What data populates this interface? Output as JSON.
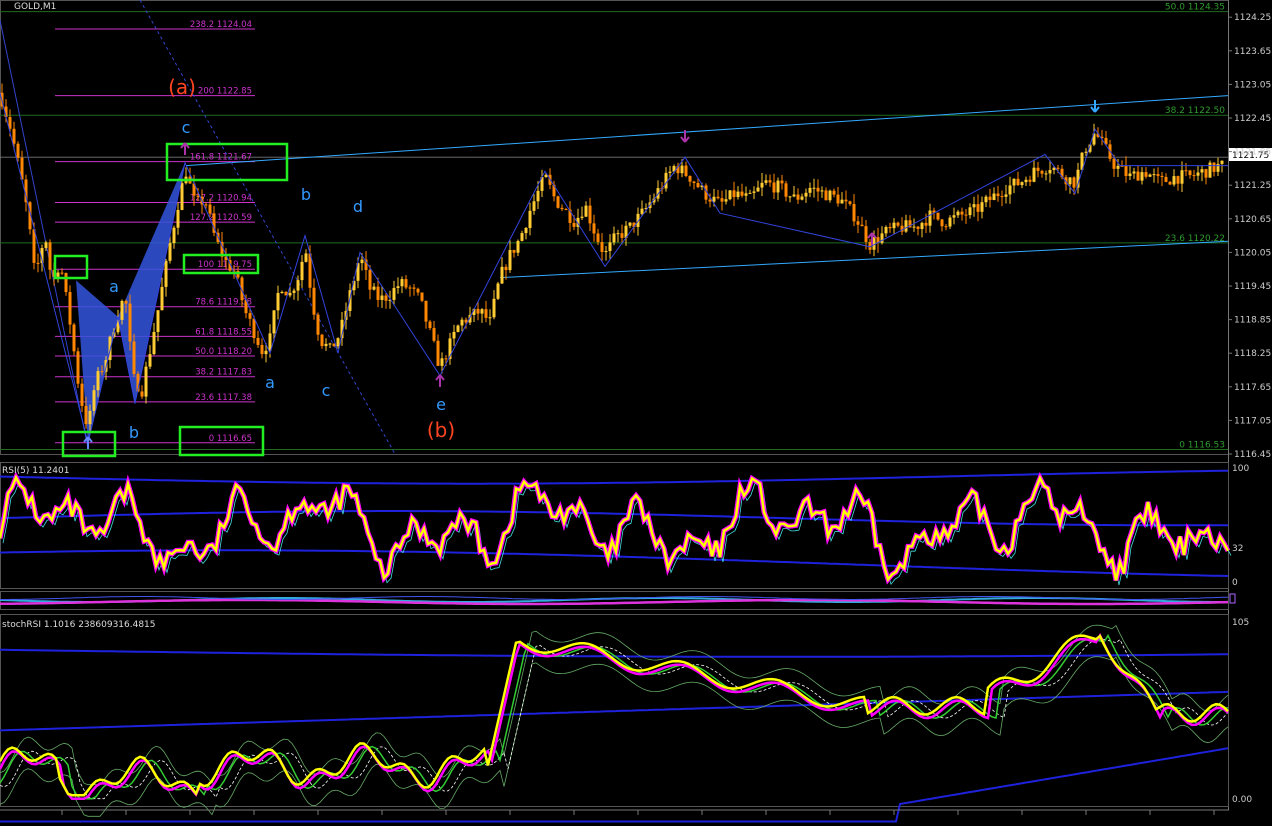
{
  "window": {
    "title": "GOLD,M1"
  },
  "colors": {
    "background": "#000000",
    "bull_candle": "#ffcc33",
    "bear_candle": "#ff8800",
    "grid_green": "#1f6b1f",
    "fib_magenta": "#cc33cc",
    "channel_cyan": "#33aaff",
    "wave_label": "#3399ff",
    "elliott_label": "#ff4422",
    "highlight_box": "#22ee22",
    "harmonic_fill": "#3355dd",
    "rsi_main": "#ffff00",
    "rsi_halo": "#ff00ff",
    "band_blue": "#1e22dd",
    "stoch_green": "#33cc33"
  },
  "price_axis": {
    "ticks": [
      "1124.25",
      "1123.65",
      "1123.05",
      "1122.45",
      "1121.85",
      "1121.25",
      "1120.65",
      "1120.05",
      "1119.45",
      "1118.85",
      "1118.25",
      "1117.65",
      "1117.05",
      "1116.45"
    ],
    "current": "1121.75"
  },
  "fib_levels": [
    {
      "label": "238.2 1124.04"
    },
    {
      "label": "200 1122.85"
    },
    {
      "label": "161.8 1121.67"
    },
    {
      "label": "127.2 1120.94"
    },
    {
      "label": "127.2 1120.59"
    },
    {
      "label": "100 1119.75"
    },
    {
      "label": "78.6 1119.08"
    },
    {
      "label": "61.8 1118.55"
    },
    {
      "label": "50.0 1118.20"
    },
    {
      "label": "38.2 1117.83"
    },
    {
      "label": "23.6 1117.38"
    },
    {
      "label": "0 1116.65"
    }
  ],
  "right_fib": [
    {
      "label": "50.0 1124.35"
    },
    {
      "label": "38.2 1122.50"
    },
    {
      "label": "23.6 1120.22"
    },
    {
      "label": "0 1116.53"
    }
  ],
  "wave_labels": [
    "(a)",
    "c",
    "a",
    "b",
    "b",
    "d",
    "a",
    "c",
    "e",
    "(b)"
  ],
  "rsi_panel": {
    "title": "RSI(5) 11.2401",
    "ticks": [
      "100",
      "32",
      "0"
    ]
  },
  "stoch_panel": {
    "title": "stochRSI 1.1016 238609316.4815",
    "ticks": [
      "105",
      "0.00"
    ]
  },
  "chart_data": {
    "type": "candlestick",
    "title": "GOLD,M1",
    "ylim": [
      1116.45,
      1124.45
    ],
    "price_path": [
      [
        0,
        1122.9
      ],
      [
        10,
        1122.3
      ],
      [
        20,
        1121.5
      ],
      [
        28,
        1120.7
      ],
      [
        35,
        1119.6
      ],
      [
        45,
        1120.4
      ],
      [
        52,
        1119.5
      ],
      [
        60,
        1119.9
      ],
      [
        70,
        1118.8
      ],
      [
        80,
        1117.5
      ],
      [
        88,
        1116.9
      ],
      [
        95,
        1117.7
      ],
      [
        105,
        1118.1
      ],
      [
        115,
        1118.8
      ],
      [
        125,
        1119.3
      ],
      [
        133,
        1117.8
      ],
      [
        142,
        1117.6
      ],
      [
        150,
        1118.3
      ],
      [
        160,
        1119.2
      ],
      [
        170,
        1120.2
      ],
      [
        180,
        1121.1
      ],
      [
        186,
        1121.5
      ],
      [
        195,
        1120.9
      ],
      [
        205,
        1121.0
      ],
      [
        215,
        1120.3
      ],
      [
        225,
        1119.9
      ],
      [
        235,
        1119.7
      ],
      [
        245,
        1119.0
      ],
      [
        255,
        1118.6
      ],
      [
        262,
        1118.3
      ],
      [
        270,
        1118.5
      ],
      [
        280,
        1119.5
      ],
      [
        290,
        1119.3
      ],
      [
        300,
        1119.7
      ],
      [
        305,
        1120.2
      ],
      [
        312,
        1119.2
      ],
      [
        320,
        1118.5
      ],
      [
        330,
        1118.3
      ],
      [
        340,
        1118.6
      ],
      [
        350,
        1119.3
      ],
      [
        360,
        1120.0
      ],
      [
        370,
        1119.4
      ],
      [
        380,
        1119.2
      ],
      [
        390,
        1119.3
      ],
      [
        400,
        1119.5
      ],
      [
        410,
        1119.4
      ],
      [
        420,
        1119.2
      ],
      [
        430,
        1118.6
      ],
      [
        440,
        1118.0
      ],
      [
        450,
        1118.4
      ],
      [
        460,
        1118.8
      ],
      [
        470,
        1118.9
      ],
      [
        480,
        1119.0
      ],
      [
        490,
        1118.8
      ],
      [
        500,
        1119.6
      ],
      [
        510,
        1120.0
      ],
      [
        520,
        1120.3
      ],
      [
        530,
        1120.8
      ],
      [
        545,
        1121.4
      ],
      [
        555,
        1121.0
      ],
      [
        565,
        1120.8
      ],
      [
        575,
        1120.6
      ],
      [
        585,
        1120.9
      ],
      [
        595,
        1120.4
      ],
      [
        605,
        1120.0
      ],
      [
        615,
        1120.3
      ],
      [
        630,
        1120.5
      ],
      [
        645,
        1120.8
      ],
      [
        660,
        1121.2
      ],
      [
        675,
        1121.6
      ],
      [
        690,
        1121.4
      ],
      [
        705,
        1121.1
      ],
      [
        720,
        1120.9
      ],
      [
        735,
        1121.1
      ],
      [
        750,
        1121.0
      ],
      [
        765,
        1121.3
      ],
      [
        780,
        1121.2
      ],
      [
        795,
        1121.0
      ],
      [
        810,
        1121.2
      ],
      [
        825,
        1121.1
      ],
      [
        840,
        1121.0
      ],
      [
        855,
        1120.7
      ],
      [
        870,
        1120.2
      ],
      [
        885,
        1120.4
      ],
      [
        900,
        1120.5
      ],
      [
        915,
        1120.5
      ],
      [
        930,
        1120.7
      ],
      [
        945,
        1120.6
      ],
      [
        960,
        1120.7
      ],
      [
        975,
        1120.8
      ],
      [
        990,
        1121.0
      ],
      [
        1005,
        1121.2
      ],
      [
        1020,
        1121.3
      ],
      [
        1035,
        1121.5
      ],
      [
        1050,
        1121.6
      ],
      [
        1065,
        1121.4
      ],
      [
        1075,
        1121.3
      ],
      [
        1085,
        1121.9
      ],
      [
        1095,
        1122.2
      ],
      [
        1105,
        1121.9
      ],
      [
        1115,
        1121.6
      ],
      [
        1130,
        1121.4
      ],
      [
        1145,
        1121.5
      ],
      [
        1160,
        1121.3
      ],
      [
        1175,
        1121.4
      ],
      [
        1190,
        1121.4
      ],
      [
        1205,
        1121.5
      ],
      [
        1220,
        1121.6
      ]
    ]
  }
}
